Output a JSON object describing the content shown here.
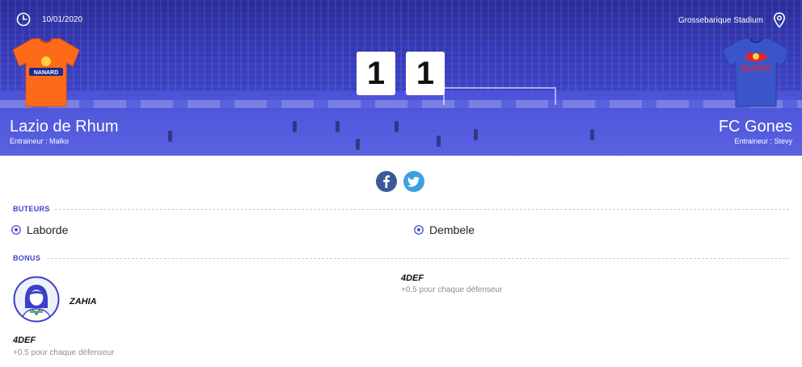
{
  "match": {
    "date": "10/01/2020",
    "stadium": "Grossebarique Stadium",
    "home": {
      "name": "Lazio de Rhum",
      "coach": "Entraineur : Malko",
      "score": "1",
      "jersey_color": "#ff6a1a",
      "jersey_text": "NANARD"
    },
    "away": {
      "name": "FC Gones",
      "coach": "Entraineur : Stevy",
      "score": "1",
      "jersey_color": "#3a55c9",
      "jersey_text": "Red Pio"
    }
  },
  "social": {
    "facebook_icon": "facebook-icon",
    "twitter_icon": "twitter-icon"
  },
  "scorers": {
    "label": "BUTEURS",
    "home": "Laborde",
    "away": "Dembele"
  },
  "bonus": {
    "label": "BONUS",
    "home": {
      "player": "ZAHIA",
      "title": "4DEF",
      "description": "+0.5 pour chaque défenseur"
    },
    "away": {
      "title": "4DEF",
      "description": "+0.5 pour chaque défenseur"
    }
  },
  "colors": {
    "hero": "#3b3fc9",
    "accent": "#3b3fc9",
    "facebook": "#3b5998",
    "twitter": "#3aa1df"
  }
}
